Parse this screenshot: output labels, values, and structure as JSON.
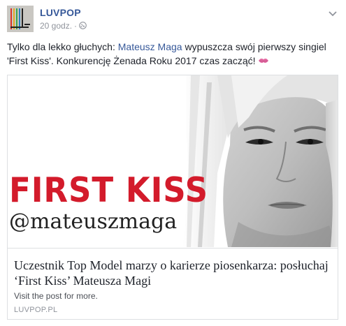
{
  "header": {
    "page_name": "LUVPOP",
    "timestamp": "20 godz.",
    "separator": "·",
    "privacy_icon": "globe-icon",
    "options_icon": "chevron-down-icon"
  },
  "post": {
    "text_before_mention": "Tylko dla lekko głuchych: ",
    "mention": "Mateusz Maga",
    "text_after_mention": " wypuszcza swój pierwszy singiel 'First Kiss'. Konkurencję Żenada Roku 2017 czas zacząć!",
    "emoji": "kiss-mark-icon"
  },
  "link_card": {
    "image_title": "FIRST KISS",
    "image_handle": "@mateuszmaga",
    "title": "Uczestnik Top Model marzy o karierze piosenkarza: posłuchaj ‘First Kiss’ Mateusza Magi",
    "description": "Visit the post for more.",
    "domain": "LUVPOP.PL"
  },
  "colors": {
    "link_blue": "#365899",
    "text": "#1d2129",
    "meta_gray": "#90949c",
    "title_red": "#d31b2b",
    "border": "#dddfe2"
  }
}
